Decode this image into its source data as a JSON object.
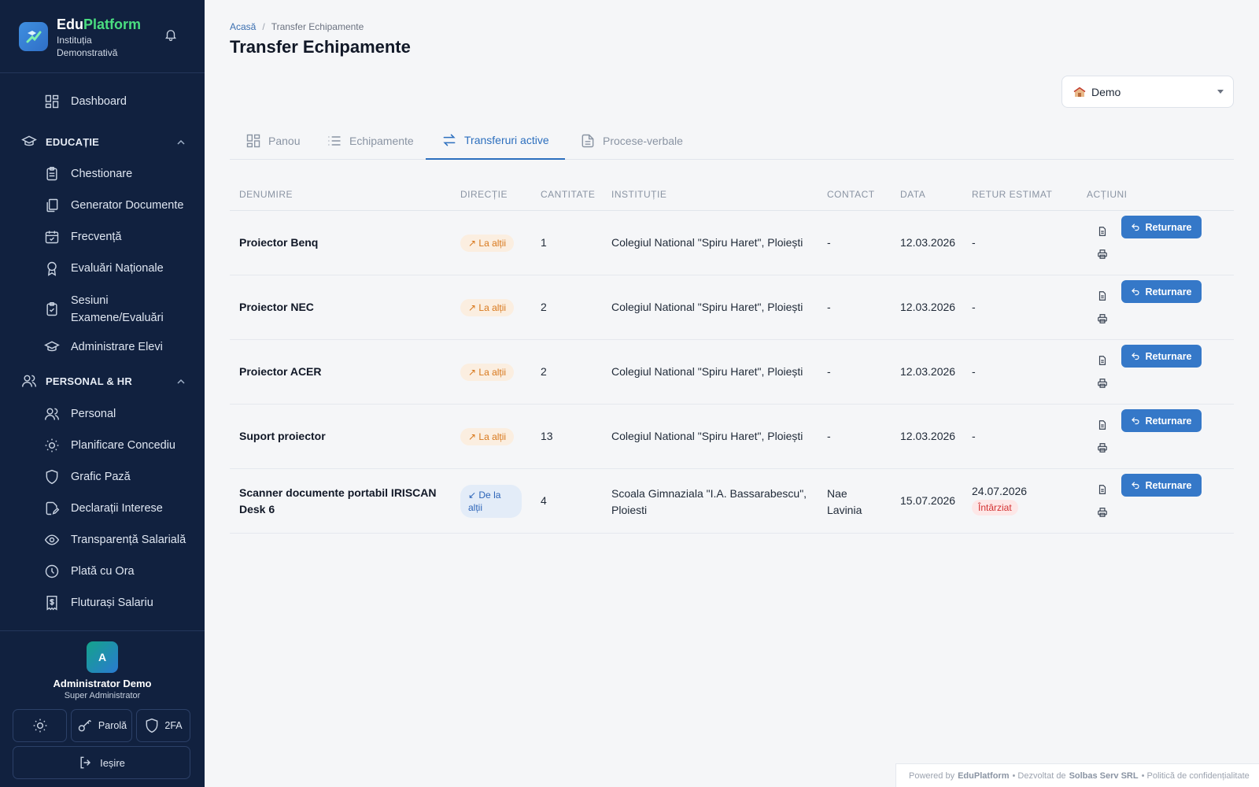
{
  "brand": {
    "name_part1": "Edu",
    "name_part2": "Platform",
    "institution": "Instituția Demonstrativă"
  },
  "nav": {
    "dashboard": "Dashboard",
    "sections": [
      {
        "title": "EDUCAȚIE",
        "items": [
          "Chestionare",
          "Generator Documente",
          "Frecvență",
          "Evaluări Naționale",
          "Sesiuni Examene/Evaluări",
          "Administrare Elevi"
        ]
      },
      {
        "title": "PERSONAL & HR",
        "items": [
          "Personal",
          "Planificare Concediu",
          "Grafic Pază",
          "Declarații Interese",
          "Transparență Salarială",
          "Plată cu Ora",
          "Fluturași Salariu"
        ]
      }
    ]
  },
  "user": {
    "initial": "A",
    "name": "Administrator Demo",
    "role": "Super Administrator",
    "password_label": "Parolă",
    "twofa_label": "2FA",
    "logout_label": "Ieșire"
  },
  "breadcrumb": {
    "home": "Acasă",
    "current": "Transfer Echipamente"
  },
  "page_title": "Transfer Echipamente",
  "school_select": {
    "value": "Demo"
  },
  "tabs": [
    "Panou",
    "Echipamente",
    "Transferuri active",
    "Procese-verbale"
  ],
  "table": {
    "headers": [
      "DENUMIRE",
      "DIRECȚIE",
      "CANTITATE",
      "INSTITUȚIE",
      "CONTACT",
      "DATA",
      "RETUR ESTIMAT",
      "ACȚIUNI"
    ],
    "return_label": "Returnare",
    "rows": [
      {
        "name": "Proiector Benq",
        "direction": "↗ La alții",
        "qty": "1",
        "institution": "Colegiul National \"Spiru Haret\", Ploiești",
        "contact": "-",
        "date": "12.03.2026",
        "return": "-",
        "status": ""
      },
      {
        "name": "Proiector NEC",
        "direction": "↗ La alții",
        "qty": "2",
        "institution": "Colegiul National \"Spiru Haret\", Ploiești",
        "contact": "-",
        "date": "12.03.2026",
        "return": "-",
        "status": ""
      },
      {
        "name": "Proiector ACER",
        "direction": "↗ La alții",
        "qty": "2",
        "institution": "Colegiul National \"Spiru Haret\", Ploiești",
        "contact": "-",
        "date": "12.03.2026",
        "return": "-",
        "status": ""
      },
      {
        "name": "Suport proiector",
        "direction": "↗ La alții",
        "qty": "13",
        "institution": "Colegiul National \"Spiru Haret\", Ploiești",
        "contact": "-",
        "date": "12.03.2026",
        "return": "-",
        "status": ""
      },
      {
        "name": "Scanner documente portabil IRISCAN Desk 6",
        "direction": "↙ De la alții",
        "qty": "4",
        "institution": "Scoala Gimnaziala \"I.A. Bassarabescu\", Ploiesti",
        "contact": "Nae Lavinia",
        "date": "15.07.2026",
        "return": "24.07.2026",
        "status": "Întârziat"
      }
    ]
  },
  "footer": {
    "powered": "Powered by",
    "brand": "EduPlatform",
    "dev": "• Dezvoltat de",
    "company": "Solbas Serv SRL",
    "policy": "• Politică de confidențialitate"
  },
  "colors": {
    "sidebar": "#11213f",
    "accent": "#2c6fbe",
    "button": "#3578c8",
    "out_badge": "#d8781c",
    "in_badge": "#2c64b8",
    "late": "#d33232",
    "brand_green": "#4ade80"
  }
}
